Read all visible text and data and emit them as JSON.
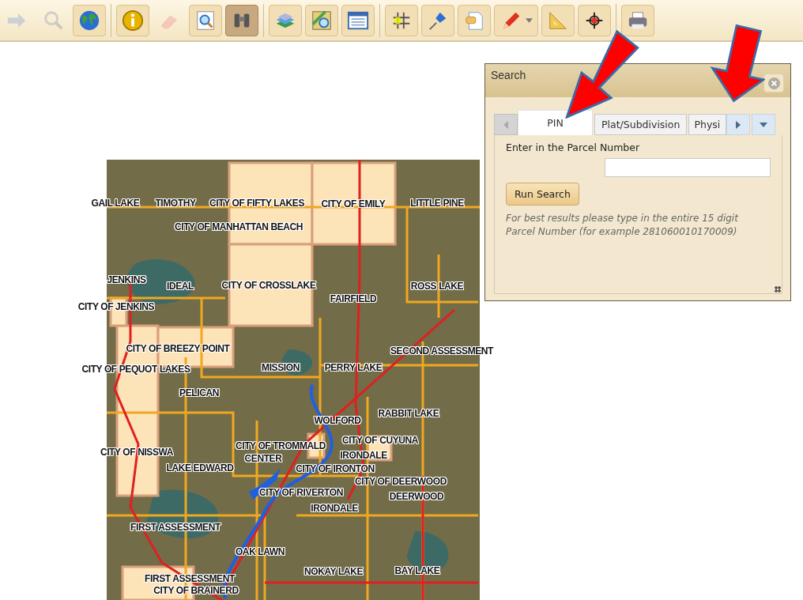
{
  "toolbar": {
    "groups": [
      {
        "tools": [
          {
            "disabled": true,
            "selected": false
          },
          {
            "disabled": true,
            "selected": false
          },
          {
            "disabled": false,
            "selected": false
          }
        ]
      },
      {
        "tools": [
          {
            "disabled": false,
            "selected": false
          },
          {
            "disabled": true,
            "selected": false
          },
          {
            "disabled": false,
            "selected": false
          },
          {
            "disabled": false,
            "selected": true
          }
        ]
      },
      {
        "tools": [
          {
            "disabled": false,
            "selected": false
          },
          {
            "disabled": false,
            "selected": false
          },
          {
            "disabled": false,
            "selected": false
          }
        ]
      },
      {
        "tools": [
          {
            "disabled": false,
            "selected": false
          },
          {
            "disabled": false,
            "selected": false
          },
          {
            "disabled": false,
            "selected": false
          },
          {
            "disabled": false,
            "selected": false
          },
          {
            "disabled": false,
            "selected": false
          },
          {
            "disabled": false,
            "selected": false
          }
        ]
      },
      {
        "tools": [
          {
            "disabled": false,
            "selected": false
          }
        ]
      }
    ]
  },
  "map": {
    "labels": [
      "GAIL LAKE",
      "TIMOTHY",
      "CITY OF FIFTY LAKES",
      "CITY OF EMILY",
      "LITTLE PINE",
      "CITY OF MANHATTAN BEACH",
      "JENKINS",
      "IDEAL",
      "CITY OF CROSSLAKE",
      "ROSS LAKE",
      "CITY OF JENKINS",
      "FAIRFIELD",
      "CITY OF BREEZY POINT",
      "SECOND ASSESSMENT",
      "CITY OF PEQUOT LAKES",
      "MISSION",
      "PERRY LAKE",
      "PELICAN",
      "WOLFORD",
      "RABBIT LAKE",
      "CITY OF NISSWA",
      "CITY OF TROMMALD",
      "CITY OF CUYUNA",
      "CENTER",
      "IRONDALE",
      "LAKE EDWARD",
      "CITY OF IRONTON",
      "CITY OF DEERWOOD",
      "CITY OF RIVERTON",
      "DEERWOOD",
      "IRONDALE",
      "FIRST ASSESSMENT",
      "OAK LAWN",
      "NOKAY LAKE",
      "BAY LAKE",
      "FIRST ASSESSMENT",
      "CITY OF BRAINERD"
    ]
  },
  "search_dialog": {
    "title": "Search",
    "scroll_left": {
      "disabled": true
    },
    "tabs": [
      {
        "label": "PIN",
        "selected": true
      },
      {
        "label": "Plat/Subdivision",
        "selected": false
      },
      {
        "label": "Physi",
        "selected": false
      }
    ],
    "scroll_right": {
      "disabled": false
    },
    "field_label": "Enter in the Parcel Number",
    "button": "Run Search",
    "help_text": "For best results please type in the entire 15 digit Parcel Number (for example 281060010170009)"
  }
}
